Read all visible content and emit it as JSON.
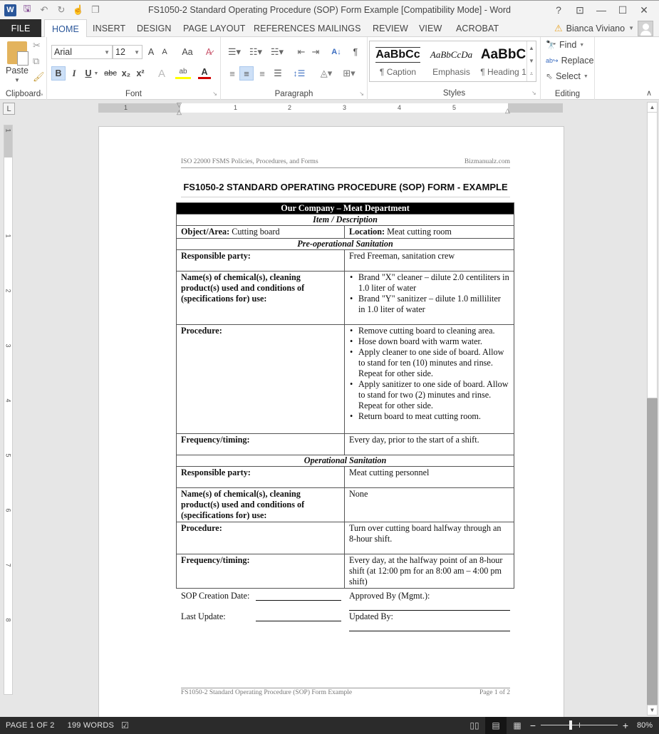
{
  "titlebar": {
    "title": "FS1050-2 Standard Operating Procedure (SOP) Form Example [Compatibility Mode] - Word",
    "app_icon": "W",
    "qat_icons": [
      "save-icon",
      "undo-icon",
      "redo-icon",
      "touch-mode-icon",
      "customize-icon"
    ],
    "controls": {
      "help": "?",
      "ribbon_display": "⊡",
      "minimize": "—",
      "maximize": "☐",
      "close": "✕"
    }
  },
  "tabs": {
    "file": "FILE",
    "items": [
      "HOME",
      "INSERT",
      "DESIGN",
      "PAGE LAYOUT",
      "REFERENCES",
      "MAILINGS",
      "REVIEW",
      "VIEW",
      "ACROBAT"
    ],
    "active": "HOME"
  },
  "user": {
    "name": "Bianca Viviano",
    "warning_icon": "⚠"
  },
  "ribbon": {
    "clipboard": {
      "label": "Clipboard",
      "paste": "Paste"
    },
    "font": {
      "label": "Font",
      "font_name": "Arial",
      "font_size": "12",
      "grow": "A",
      "shrink": "A",
      "change_case": "Aa",
      "bold": "B",
      "italic": "I",
      "underline": "U",
      "strikethrough": "abc",
      "subscript": "x₂",
      "superscript": "x²",
      "highlight_color": "#ffff00",
      "font_color": "#d00000"
    },
    "paragraph": {
      "label": "Paragraph",
      "sort": "A↓",
      "pilcrow": "¶"
    },
    "styles": {
      "label": "Styles",
      "items": [
        {
          "sample": "AaBbCc",
          "name": "¶ Caption"
        },
        {
          "sample": "AaBbCcDa",
          "name": "Emphasis"
        },
        {
          "sample": "AaBbC",
          "name": "¶ Heading 1"
        }
      ]
    },
    "editing": {
      "label": "Editing",
      "find": "Find",
      "replace": "Replace",
      "select": "Select"
    }
  },
  "ruler": {
    "tab_selector": "L",
    "h_numbers": [
      "1",
      "1",
      "2",
      "3",
      "4",
      "5"
    ],
    "v_numbers": [
      "1",
      "1",
      "2",
      "3",
      "4",
      "5",
      "6",
      "7",
      "8"
    ]
  },
  "document": {
    "header_left": "ISO 22000 FSMS Policies, Procedures, and Forms",
    "header_right": "Bizmanualz.com",
    "title": "FS1050-2 STANDARD OPERATING PROCEDURE (SOP) FORM - EXAMPLE",
    "table": {
      "company": "Our Company – Meat Department",
      "item_description": "Item / Description",
      "object_label": "Object/Area:",
      "object_value": "Cutting board",
      "location_label": "Location:",
      "location_value": "Meat cutting room",
      "preop": {
        "heading": "Pre-operational Sanitation",
        "responsible_label": "Responsible party:",
        "responsible_value": "Fred Freeman, sanitation crew",
        "chemicals_label": "Name(s) of chemical(s), cleaning product(s) used and conditions of (specifications for) use:",
        "chemicals": [
          "Brand \"X\" cleaner – dilute 2.0 centiliters in 1.0 liter of water",
          "Brand \"Y\" sanitizer – dilute 1.0 milliliter in 1.0 liter of water"
        ],
        "procedure_label": "Procedure:",
        "procedure": [
          "Remove cutting board to cleaning area.",
          "Hose down board with warm water.",
          "Apply cleaner to one side of board. Allow to stand for ten (10) minutes and rinse.  Repeat for other side.",
          "Apply sanitizer to one side of board. Allow to stand for two (2) minutes and rinse.  Repeat for other side.",
          "Return board to meat cutting room."
        ],
        "frequency_label": "Frequency/timing:",
        "frequency_value": "Every day, prior to the start of a shift."
      },
      "operational": {
        "heading": "Operational Sanitation",
        "responsible_label": "Responsible party:",
        "responsible_value": "Meat cutting personnel",
        "chemicals_label": "Name(s) of chemical(s), cleaning product(s) used and conditions of (specifications for) use:",
        "chemicals_value": "None",
        "procedure_label": "Procedure:",
        "procedure_value": "Turn over cutting board halfway through an 8-hour shift.",
        "frequency_label": "Frequency/timing:",
        "frequency_value": "Every day, at the halfway point of an 8-hour shift (at 12:00 pm for an 8:00 am – 4:00 pm shift)"
      }
    },
    "signatures": {
      "creation_date": "SOP Creation Date:",
      "approved_by": "Approved By (Mgmt.):",
      "last_update": "Last Update:",
      "updated_by": "Updated By:"
    },
    "footer_left": "FS1050-2 Standard Operating Procedure (SOP) Form Example",
    "footer_right": "Page 1 of 2"
  },
  "statusbar": {
    "page": "PAGE 1 OF 2",
    "words": "199 WORDS",
    "zoom": "80%",
    "zoom_level_percent": 80
  },
  "colors": {
    "accent": "#2b579a",
    "statusbar": "#2b2b2b"
  }
}
